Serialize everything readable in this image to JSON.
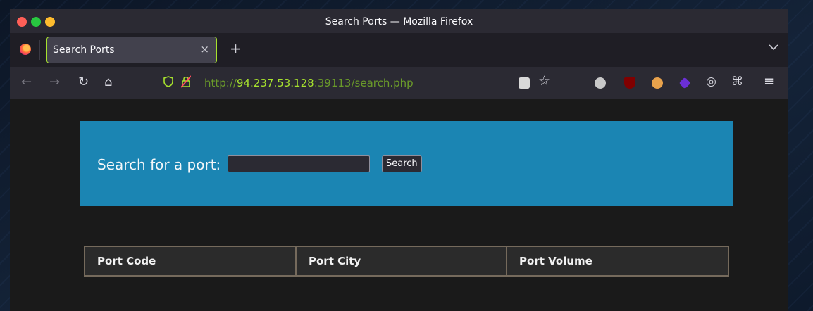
{
  "window": {
    "title": "Search Ports — Mozilla Firefox"
  },
  "tabs": [
    {
      "label": "Search Ports",
      "close_icon": "×",
      "active": true
    }
  ],
  "tabbar": {
    "new_tab_icon": "+",
    "tab_list_icon": "⌄"
  },
  "navbar": {
    "back_icon": "←",
    "forward_icon": "→",
    "reload_icon": "↻",
    "home_icon": "⌂",
    "url_scheme": "http://",
    "url_host": "94.237.53.128",
    "url_rest": ":39113/search.php",
    "extensions": [
      "reader-mode-icon",
      "bookmark-star-icon",
      "extension-1-icon",
      "ublock-origin-icon",
      "extension-3-icon",
      "extension-4-icon",
      "cookie-icon",
      "extensions-puzzle-icon",
      "app-menu-icon"
    ]
  },
  "page": {
    "search_label": "Search for a port:",
    "search_value": "",
    "search_button": "Search",
    "table_headers": [
      "Port Code",
      "Port City",
      "Port Volume"
    ],
    "banner_color": "#1b85b3"
  },
  "colors": {
    "accent": "#a7e22e",
    "close": "#ff5f57",
    "minimize": "#febc2e",
    "maximize": "#28c840"
  }
}
